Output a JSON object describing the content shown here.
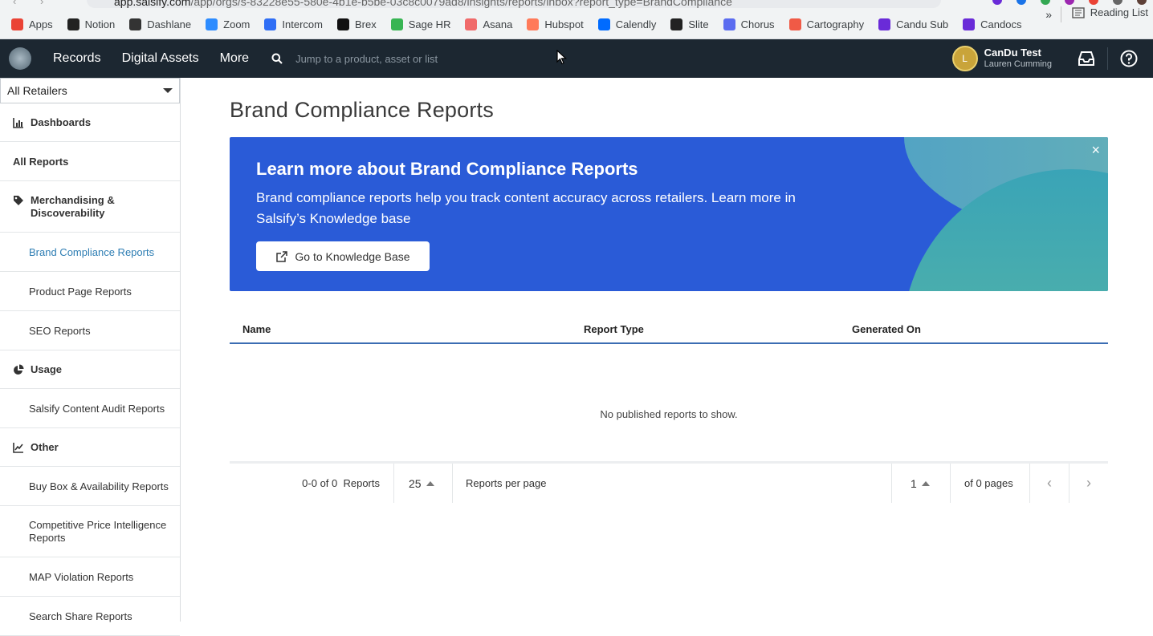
{
  "browser": {
    "url_host": "app.salsify.com",
    "url_path": "/app/orgs/s-83228e55-580e-4b1e-b5be-03c8c0079ad8/insights/reports/inbox?report_type=BrandCompliance",
    "bookmarks": [
      {
        "label": "Apps",
        "icon": "apps-grid-icon",
        "color": "#ea4335"
      },
      {
        "label": "Notion",
        "icon": "notion-icon",
        "color": "#222222"
      },
      {
        "label": "Dashlane",
        "icon": "dashlane-icon",
        "color": "#333333"
      },
      {
        "label": "Zoom",
        "icon": "zoom-icon",
        "color": "#2d8cff"
      },
      {
        "label": "Intercom",
        "icon": "intercom-icon",
        "color": "#2f6ef5"
      },
      {
        "label": "Brex",
        "icon": "brex-icon",
        "color": "#111111"
      },
      {
        "label": "Sage HR",
        "icon": "sage-hr-icon",
        "color": "#38b553"
      },
      {
        "label": "Asana",
        "icon": "asana-icon",
        "color": "#f06a6a"
      },
      {
        "label": "Hubspot",
        "icon": "hubspot-icon",
        "color": "#ff7a59"
      },
      {
        "label": "Calendly",
        "icon": "calendly-icon",
        "color": "#006bff"
      },
      {
        "label": "Slite",
        "icon": "slite-icon",
        "color": "#222222"
      },
      {
        "label": "Chorus",
        "icon": "chorus-icon",
        "color": "#5b6cf0"
      },
      {
        "label": "Cartography",
        "icon": "cartography-icon",
        "color": "#f05a46"
      },
      {
        "label": "Candu Sub",
        "icon": "candu-sub-icon",
        "color": "#6a2bd8"
      },
      {
        "label": "Candocs",
        "icon": "candocs-icon",
        "color": "#6a2bd8"
      }
    ],
    "more_label": "»",
    "reading_list": "Reading List"
  },
  "topnav": {
    "items": [
      "Records",
      "Digital Assets",
      "More"
    ],
    "search_placeholder": "Jump to a product, asset or list",
    "user_initial": "L",
    "user_name": "CanDu Test",
    "user_org": "Lauren Cumming"
  },
  "sidebar": {
    "retailer_select": "All Retailers",
    "dashboards": "Dashboards",
    "all_reports": "All Reports",
    "merch_section": "Merchandising & Discoverability",
    "merch_items": [
      "Brand Compliance Reports",
      "Product Page Reports",
      "SEO Reports"
    ],
    "usage_section": "Usage",
    "usage_items": [
      "Salsify Content Audit Reports"
    ],
    "other_section": "Other",
    "other_items": [
      "Buy Box & Availability Reports",
      "Competitive Price Intelligence Reports",
      "MAP Violation Reports",
      "Search Share Reports"
    ]
  },
  "main": {
    "title": "Brand Compliance Reports",
    "banner": {
      "title": "Learn more about Brand Compliance Reports",
      "text": "Brand compliance reports help you track content accuracy across retailers. Learn more in Salsify’s Knowledge base",
      "button": "Go to Knowledge Base",
      "close": "×",
      "bg_color": "#2a5bd7"
    },
    "table": {
      "columns": [
        "Name",
        "Report Type",
        "Generated On"
      ],
      "empty_message": "No published reports to show."
    },
    "pager": {
      "range": "0-0 of 0  Reports",
      "per_page_value": "25",
      "per_page_label": "Reports per page",
      "page_value": "1",
      "of_pages": "of 0 pages"
    }
  }
}
